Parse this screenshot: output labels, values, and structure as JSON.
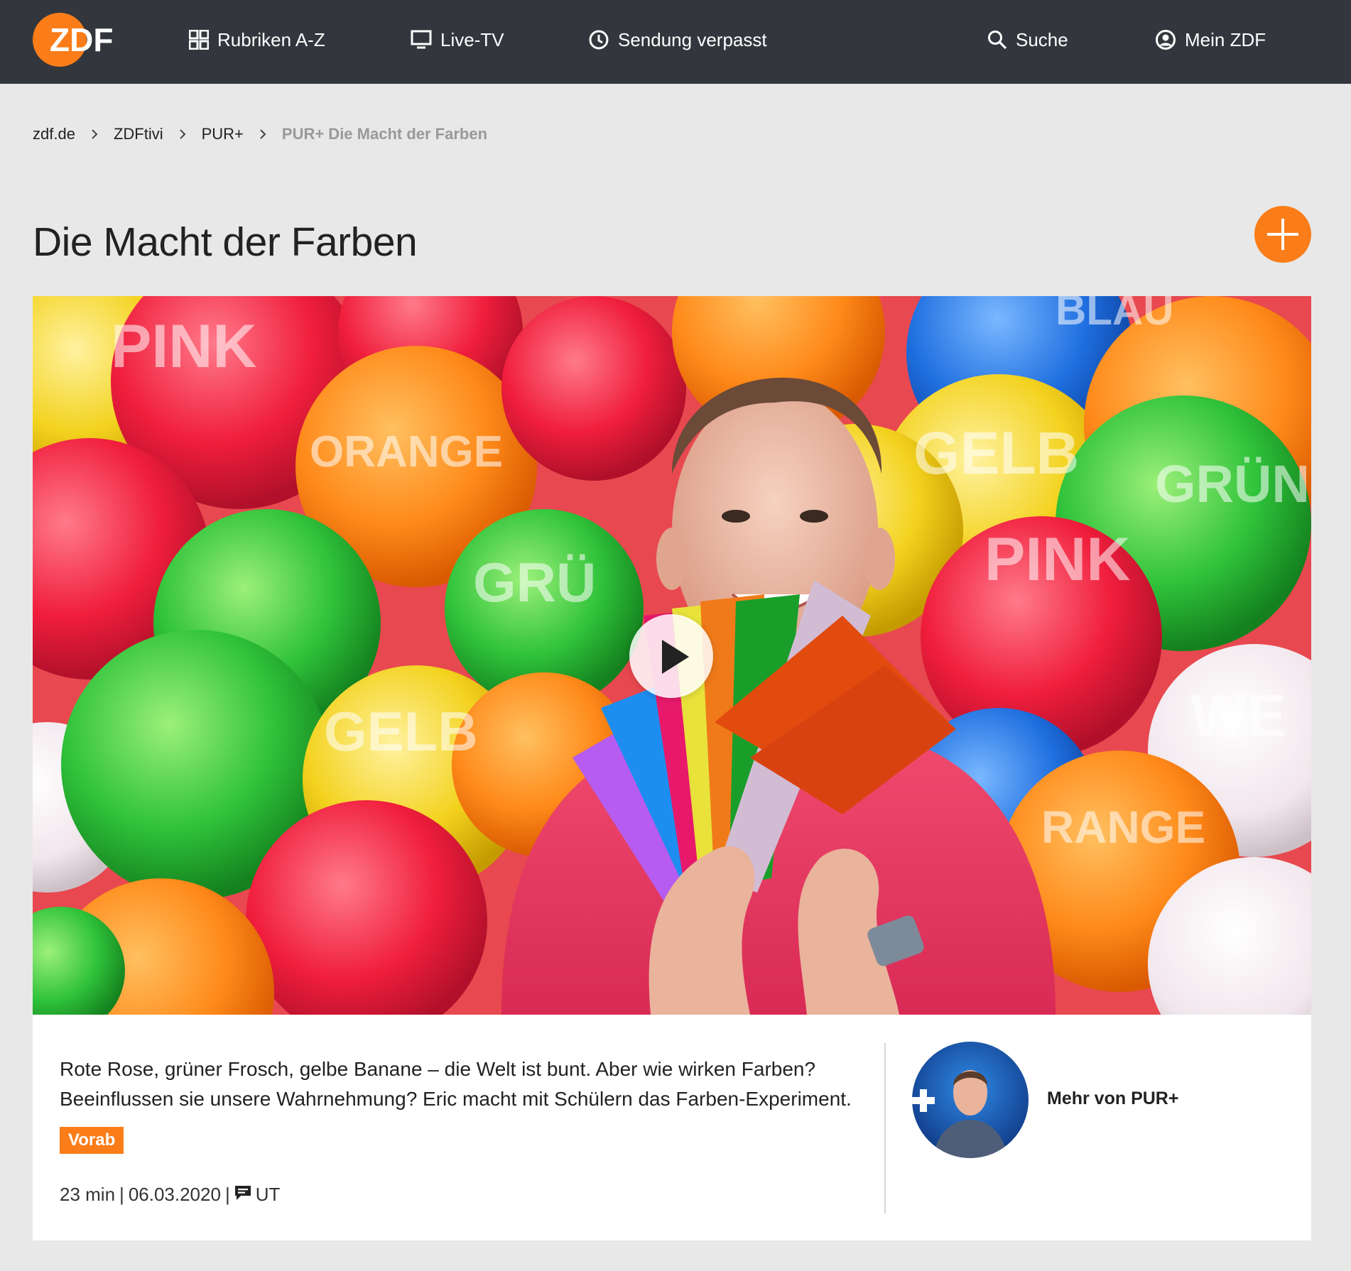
{
  "header": {
    "logo_text": "ZDF",
    "nav": [
      {
        "label": "Rubriken A-Z",
        "icon": "grid-icon"
      },
      {
        "label": "Live-TV",
        "icon": "tv-icon"
      },
      {
        "label": "Sendung verpasst",
        "icon": "clock-icon"
      },
      {
        "label": "Suche",
        "icon": "search-icon"
      },
      {
        "label": "Mein ZDF",
        "icon": "user-icon"
      }
    ]
  },
  "breadcrumb": [
    "zdf.de",
    "ZDFtivi",
    "PUR+",
    "PUR+ Die Macht der Farben"
  ],
  "page": {
    "title": "Die Macht der Farben",
    "add_icon": "plus-icon"
  },
  "hero": {
    "play_icon": "play-icon",
    "image_words": [
      "PINK",
      "ORANGE",
      "BLAU",
      "GELB",
      "GRÜN",
      "GRÜ",
      "PINK",
      "GELB",
      "WE",
      "RANGE"
    ]
  },
  "info": {
    "description": "Rote Rose, grüner Frosch, gelbe Banane – die Welt ist bunt. Aber wie wirken Farben? Beeinflussen sie unsere Wahrnehmung? Eric macht mit Schülern das Farben-Experiment.",
    "badge": "Vorab",
    "duration": "23 min",
    "date": "06.03.2020",
    "subtitle_label": "UT",
    "subtitle_icon": "subtitles-icon",
    "more_label": "Mehr von PUR+"
  },
  "colors": {
    "header_bg": "#33363c",
    "accent": "#fa7d19",
    "page_bg": "#e8e8e8"
  }
}
